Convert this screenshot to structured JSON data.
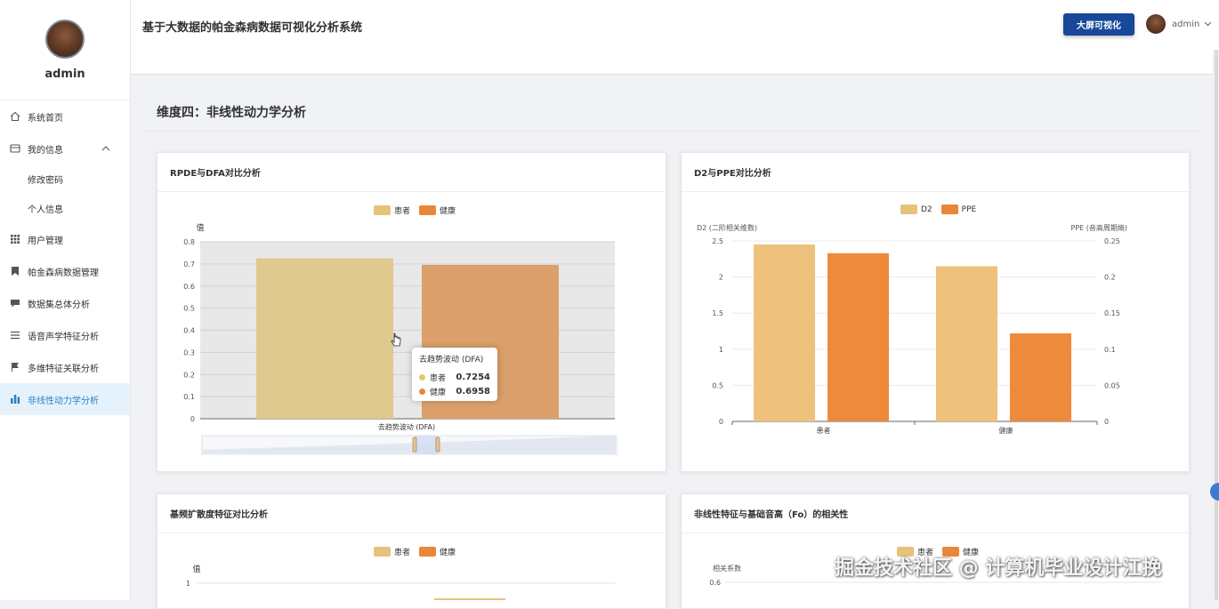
{
  "profile": {
    "name": "admin"
  },
  "sidebar": {
    "items": [
      {
        "label": "系统首页",
        "icon": "home-icon"
      },
      {
        "label": "我的信息",
        "icon": "id-card-icon"
      },
      {
        "label": "修改密码"
      },
      {
        "label": "个人信息"
      },
      {
        "label": "用户管理",
        "icon": "grid-icon"
      },
      {
        "label": "帕金森病数据管理",
        "icon": "bookmark-icon"
      },
      {
        "label": "数据集总体分析",
        "icon": "chat-icon"
      },
      {
        "label": "语音声学特征分析",
        "icon": "list-icon"
      },
      {
        "label": "多维特征关联分析",
        "icon": "flag-icon"
      },
      {
        "label": "非线性动力学分析",
        "icon": "bar-chart-icon"
      }
    ]
  },
  "header": {
    "title": "基于大数据的帕金森病数据可视化分析系统",
    "bigscreen_label": "大屏可视化",
    "user": "admin"
  },
  "section": {
    "title": "维度四：非线性动力学分析"
  },
  "colors": {
    "patient": "#e6c27a",
    "healthy": "#e8873a",
    "active": "#2f7fc0",
    "button": "#17489a"
  },
  "cards": {
    "rpde": {
      "title": "RPDE与DFA对比分析"
    },
    "d2": {
      "title": "D2与PPE对比分析"
    },
    "spread": {
      "title": "基频扩散度特征对比分析"
    },
    "corr": {
      "title": "非线性特征与基础音高（Fo）的相关性"
    }
  },
  "tooltip": {
    "title": "去趋势波动 (DFA)",
    "rows": [
      {
        "name": "患者",
        "value": "0.7254"
      },
      {
        "name": "健康",
        "value": "0.6958"
      }
    ]
  },
  "watermark": "掘金技术社区 @ 计算机毕业设计江挽",
  "chart_data": [
    {
      "type": "bar",
      "title": "RPDE与DFA对比分析",
      "ylabel": "值",
      "ylim": [
        0,
        0.8
      ],
      "yticks": [
        "0",
        "0.1",
        "0.2",
        "0.3",
        "0.4",
        "0.5",
        "0.6",
        "0.7",
        "0.8"
      ],
      "categories": [
        "去趋势波动 (DFA)"
      ],
      "series": [
        {
          "name": "患者",
          "values": [
            0.7254
          ]
        },
        {
          "name": "健康",
          "values": [
            0.6958
          ]
        }
      ],
      "legend": "top-center"
    },
    {
      "type": "bar",
      "title": "D2与PPE对比分析",
      "ylabel_left": "D2 (二阶相关维数)",
      "ylabel_right": "PPE (音高周期熵)",
      "ylim_left": [
        0,
        2.5
      ],
      "ylim_right": [
        0,
        0.25
      ],
      "yticks_left": [
        "0",
        "0.5",
        "1",
        "1.5",
        "2",
        "2.5"
      ],
      "yticks_right": [
        "0",
        "0.05",
        "0.1",
        "0.15",
        "0.2",
        "0.25"
      ],
      "categories": [
        "患者",
        "健康"
      ],
      "series": [
        {
          "name": "D2",
          "values": [
            2.45,
            2.15
          ]
        },
        {
          "name": "PPE",
          "values": [
            0.233,
            0.122
          ]
        }
      ],
      "legend": "top-center"
    },
    {
      "type": "bar",
      "title": "基频扩散度特征对比分析",
      "ylabel": "值",
      "ytick_top": "1",
      "series": [
        {
          "name": "患者"
        },
        {
          "name": "健康"
        }
      ],
      "legend": "top-center"
    },
    {
      "type": "bar",
      "title": "非线性特征与基础音高（Fo）的相关性",
      "ylabel": "相关系数",
      "ytick_top": "0.6",
      "series": [
        {
          "name": "患者"
        },
        {
          "name": "健康"
        }
      ],
      "legend": "top-center"
    }
  ]
}
